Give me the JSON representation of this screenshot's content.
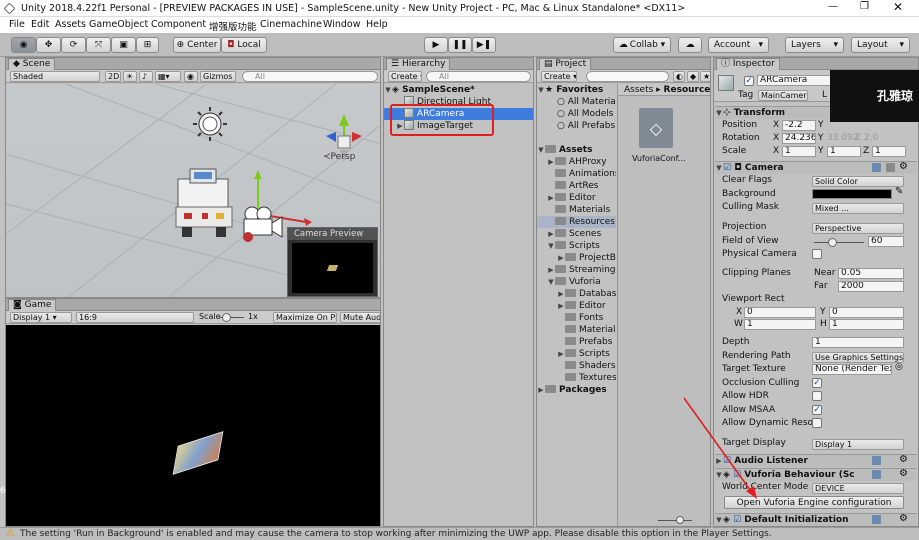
{
  "window": {
    "title": "Unity 2018.4.22f1 Personal - [PREVIEW PACKAGES IN USE] - SampleScene.unity - New Unity Project - PC, Mac & Linux Standalone* <DX11>"
  },
  "menu": [
    "File",
    "Edit",
    "Assets",
    "GameObject",
    "Component",
    "增强版功能",
    "Cinemachine",
    "Window",
    "Help"
  ],
  "toolbar": {
    "center": "Center",
    "local": "Local",
    "collab": "Collab ▾",
    "account": "Account",
    "layers": "Layers",
    "layout": "Layout"
  },
  "scene": {
    "tab": "Scene",
    "shaded": "Shaded",
    "mode2d": "2D",
    "gizmos": "Gizmos",
    "search": "All",
    "persp": "≺Persp",
    "preview_title": "Camera Preview"
  },
  "game": {
    "tab": "Game",
    "display": "Display 1",
    "aspect": "16:9",
    "scale_label": "Scale",
    "scale_value": "1x",
    "maximize": "Maximize On Play",
    "mute": "Mute Audio"
  },
  "hierarchy": {
    "tab": "Hierarchy",
    "create": "Create",
    "search": "All",
    "scene": "SampleScene*",
    "items": [
      "Directional Light",
      "ARCamera",
      "ImageTarget"
    ]
  },
  "project": {
    "tab": "Project",
    "create": "Create",
    "breadcrumb": [
      "Assets",
      "Resources"
    ],
    "asset_name": "VuforiaConf...",
    "favorites": {
      "title": "Favorites",
      "items": [
        "All Material",
        "All Models",
        "All Prefabs"
      ]
    },
    "assets_title": "Assets",
    "tree": [
      {
        "label": "AHProxy",
        "depth": 1,
        "fold": true
      },
      {
        "label": "Animations",
        "depth": 1,
        "fold": false
      },
      {
        "label": "ArtRes",
        "depth": 1,
        "fold": false
      },
      {
        "label": "Editor",
        "depth": 1,
        "fold": true
      },
      {
        "label": "Materials",
        "depth": 1,
        "fold": false
      },
      {
        "label": "Resources",
        "depth": 1,
        "fold": false,
        "selected": true
      },
      {
        "label": "Scenes",
        "depth": 1,
        "fold": true
      },
      {
        "label": "Scripts",
        "depth": 1,
        "fold": true,
        "open": true
      },
      {
        "label": "ProjectB",
        "depth": 2,
        "fold": true
      },
      {
        "label": "Streaming",
        "depth": 1,
        "fold": true
      },
      {
        "label": "Vuforia",
        "depth": 1,
        "fold": true,
        "open": true
      },
      {
        "label": "Databas",
        "depth": 2,
        "fold": true
      },
      {
        "label": "Editor",
        "depth": 2,
        "fold": true
      },
      {
        "label": "Fonts",
        "depth": 2,
        "fold": false
      },
      {
        "label": "Materials",
        "depth": 2,
        "fold": false
      },
      {
        "label": "Prefabs",
        "depth": 2,
        "fold": false
      },
      {
        "label": "Scripts",
        "depth": 2,
        "fold": true
      },
      {
        "label": "Shaders",
        "depth": 2,
        "fold": false
      },
      {
        "label": "Textures",
        "depth": 2,
        "fold": false
      }
    ],
    "packages": "Packages"
  },
  "inspector": {
    "tab": "Inspector",
    "object_name": "ARCamera",
    "tag_label": "Tag",
    "tag_value": "MainCamera",
    "layer_abbrev": "L",
    "transform": {
      "title": "Transform",
      "position_label": "Position",
      "rotation_label": "Rotation",
      "scale_label": "Scale",
      "position": {
        "x": "-2.2",
        "y": "Y"
      },
      "rotation": {
        "x": "24.236",
        "y": "Y",
        "yval": "33.092",
        "z": "Z",
        "zval": "2.0"
      },
      "scale": {
        "x": "1",
        "y": "1",
        "z": "1"
      }
    },
    "camera": {
      "title": "Camera",
      "clear_flags_label": "Clear Flags",
      "clear_flags": "Solid Color",
      "background_label": "Background",
      "culling_label": "Culling Mask",
      "culling": "Mixed ...",
      "projection_label": "Projection",
      "projection": "Perspective",
      "fov_label": "Field of View",
      "fov": "60",
      "physical_label": "Physical Camera",
      "clipping_label": "Clipping Planes",
      "near_label": "Near",
      "near": "0.05",
      "far_label": "Far",
      "far": "2000",
      "viewport_label": "Viewport Rect",
      "vx": "0",
      "vy": "0",
      "vw": "1",
      "vh": "1",
      "x_label": "X",
      "y_label": "Y",
      "w_label": "W",
      "h_label": "H",
      "depth_label": "Depth",
      "depth": "1",
      "rpath_label": "Rendering Path",
      "rpath": "Use Graphics Settings",
      "target_label": "Target Texture",
      "target": "None (Render Tex",
      "occlusion_label": "Occlusion Culling",
      "hdr_label": "Allow HDR",
      "msaa_label": "Allow MSAA",
      "dynres_label": "Allow Dynamic Reso",
      "display_label": "Target Display",
      "display": "Display 1"
    },
    "audio_listener": "Audio Listener",
    "vuforia": {
      "title": "Vuforia Behaviour (Sc",
      "world_label": "World Center Mode",
      "world": "DEVICE",
      "open_button": "Open Vuforia Engine configuration"
    },
    "default_init": "Default Initialization"
  },
  "overlay_text": "孔雅琼",
  "status": {
    "message": "The setting 'Run in Background' is enabled and may cause the camera to stop working after minimizing the UWP app. Please disable this option in the Player Settings."
  },
  "colors": {
    "highlight_box": "#e02020",
    "selection": "#3e7ce0",
    "arrow": "#e02020"
  }
}
